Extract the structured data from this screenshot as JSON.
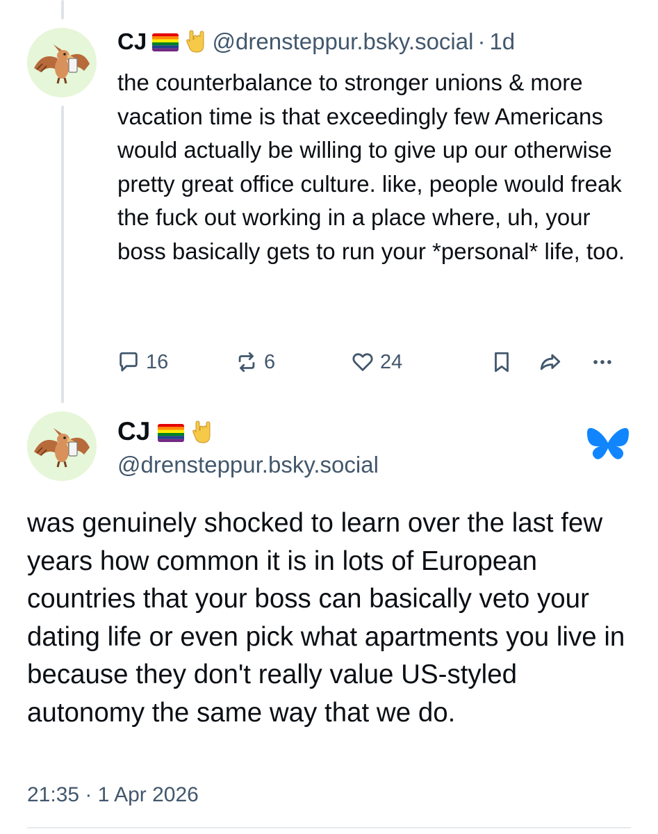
{
  "reply": {
    "author_name": "CJ",
    "author_handle": "@drensteppur.bsky.social",
    "separator": "·",
    "time_ago": "1d",
    "text": "the counterbalance to stronger unions & more vacation time is that exceedingly few Americans would actually be willing to give up our otherwise pretty great office culture. like, people would freak the fuck out working in a place where, uh, your boss basically gets to run your *personal* life, too.",
    "reply_count": "16",
    "repost_count": "6",
    "like_count": "24"
  },
  "main_post": {
    "author_name": "CJ",
    "author_handle": "@drensteppur.bsky.social",
    "text": "was genuinely shocked to learn over the last few years how common it is in lots of European countries that your boss can basically veto your dating life or even pick what apartments you live in because they don't really value US-styled autonomy the same way that we do.",
    "timestamp": "21:35 · 1 Apr 2026"
  },
  "icons": {
    "reply": "speech-bubble-icon",
    "repost": "repost-arrows-icon",
    "like": "heart-icon",
    "bookmark": "bookmark-icon",
    "share": "share-arrow-icon",
    "more": "ellipsis-icon",
    "brand": "bluesky-butterfly-icon",
    "flag": "rainbow-flag-icon",
    "hand": "rock-on-hand-icon",
    "avatar": "pterodactyl-avatar"
  },
  "colors": {
    "text": "#0b0f14",
    "muted": "#42576c",
    "brand_blue": "#1185fe",
    "avatar_bg": "#e6f6d8",
    "thread_line": "#dfe3e8"
  }
}
